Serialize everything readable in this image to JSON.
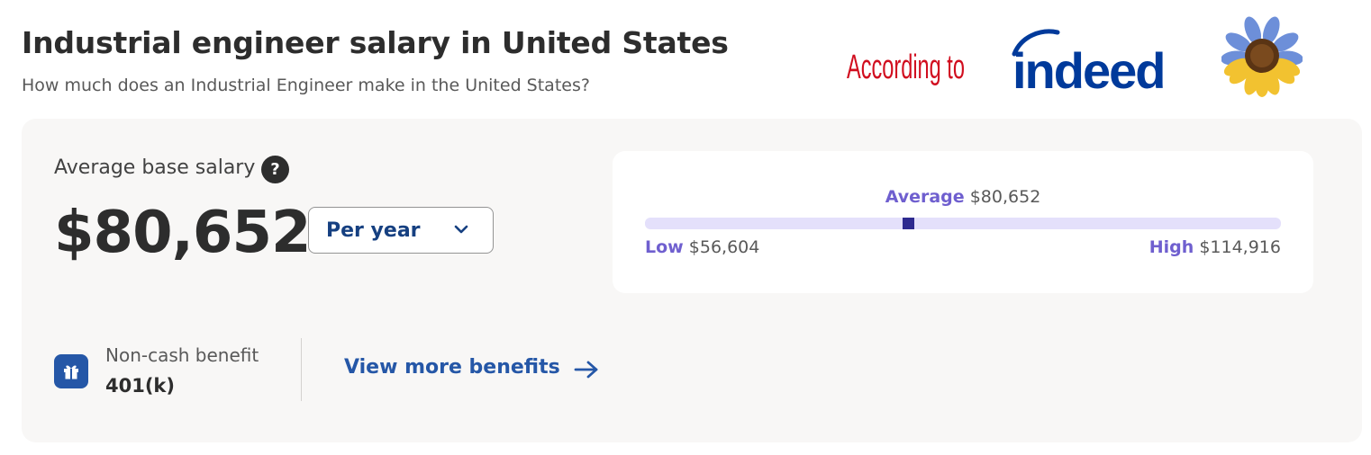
{
  "header": {
    "title": "Industrial engineer salary in United States",
    "subtitle": "How much does an Industrial Engineer make in the United States?"
  },
  "attribution": {
    "prefix": "According to",
    "logo_text": "indeed",
    "logo_color": "#003a9b",
    "prefix_color": "#d10e1f",
    "icon": "sunflower-icon"
  },
  "salary": {
    "label": "Average base salary",
    "help_icon": "?",
    "value": "$80,652",
    "period": "Per year"
  },
  "range": {
    "average_label": "Average",
    "average_value": "$80,652",
    "low_label": "Low",
    "low_value": "$56,604",
    "high_label": "High",
    "high_value": "$114,916",
    "average_position_fraction": 0.413,
    "accent_color": "#6f5fcf",
    "bar_color": "#e4e0fb",
    "marker_color": "#2e2a8f"
  },
  "benefits": {
    "label": "Non-cash benefit",
    "value": "401(k)",
    "icon": "gift-icon",
    "link_label": "View more benefits",
    "link_icon": "arrow-right-icon"
  }
}
